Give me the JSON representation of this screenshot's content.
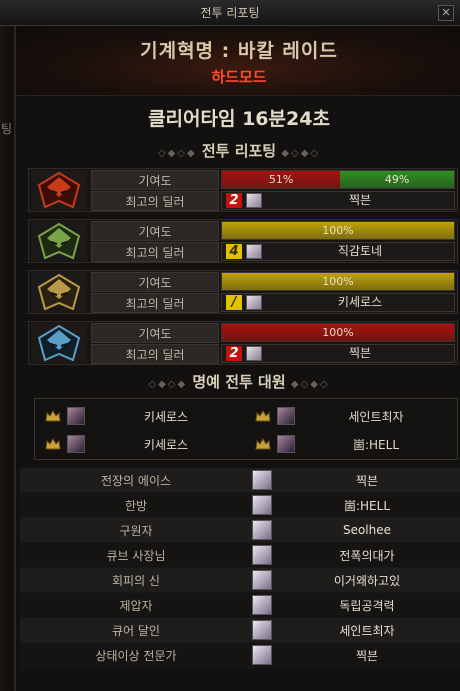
{
  "window": {
    "title": "전투 리포팅"
  },
  "header": {
    "raid_title": "기계혁명 : 바칼 레이드",
    "difficulty": "하드모드",
    "clear_time": "클리어타임  16분24초"
  },
  "sections": {
    "battle_report": "전투 리포팅",
    "honor_rep": "명예 전투 대원"
  },
  "labels": {
    "contribution": "기여도",
    "best_dealer": "최고의 딜러"
  },
  "bosses": [
    {
      "icon": "red-boss-helm-icon",
      "contribution": [
        {
          "label": "51%",
          "value": 51,
          "color": "#a8110f"
        },
        {
          "label": "49%",
          "value": 49,
          "color": "#2f8f23"
        }
      ],
      "dealer_rank": "2",
      "dealer_rank_color": "red",
      "dealer_name": "찍븐"
    },
    {
      "icon": "green-boss-helm-icon",
      "contribution": [
        {
          "label": "100%",
          "value": 100,
          "color": "#bfa20a"
        }
      ],
      "dealer_rank": "4",
      "dealer_rank_color": "gold",
      "dealer_name": "직감토네"
    },
    {
      "icon": "gold-boss-helm-icon",
      "contribution": [
        {
          "label": "100%",
          "value": 100,
          "color": "#bfa20a"
        }
      ],
      "dealer_rank": "/",
      "dealer_rank_color": "gold",
      "dealer_name": "키세로스"
    },
    {
      "icon": "blue-boss-helm-icon",
      "contribution": [
        {
          "label": "100%",
          "value": 100,
          "color": "#a8110f"
        }
      ],
      "dealer_rank": "2",
      "dealer_rank_color": "red",
      "dealer_name": "찍븐"
    }
  ],
  "honor_members": [
    {
      "name": "키세로스"
    },
    {
      "name": "세인트최자"
    },
    {
      "name": "키세로스"
    },
    {
      "name": "崮:HELL"
    }
  ],
  "awards": [
    {
      "title": "전장의 에이스",
      "name": "찍븐"
    },
    {
      "title": "한방",
      "name": "崮:HELL"
    },
    {
      "title": "구원자",
      "name": "Seolhee"
    },
    {
      "title": "큐브 사장님",
      "name": "전폭의대가"
    },
    {
      "title": "회피의 신",
      "name": "이거왜하고있"
    },
    {
      "title": "제압자",
      "name": "독립공격력"
    },
    {
      "title": "큐어 달인",
      "name": "세인트최자"
    },
    {
      "title": "상태이상 전문가",
      "name": "찍븐"
    }
  ],
  "side_text": "팅",
  "colors": {
    "accent_red": "#ff4a2e",
    "bar_red": "#a8110f",
    "bar_green": "#2f8f23",
    "bar_gold": "#bfa20a"
  }
}
